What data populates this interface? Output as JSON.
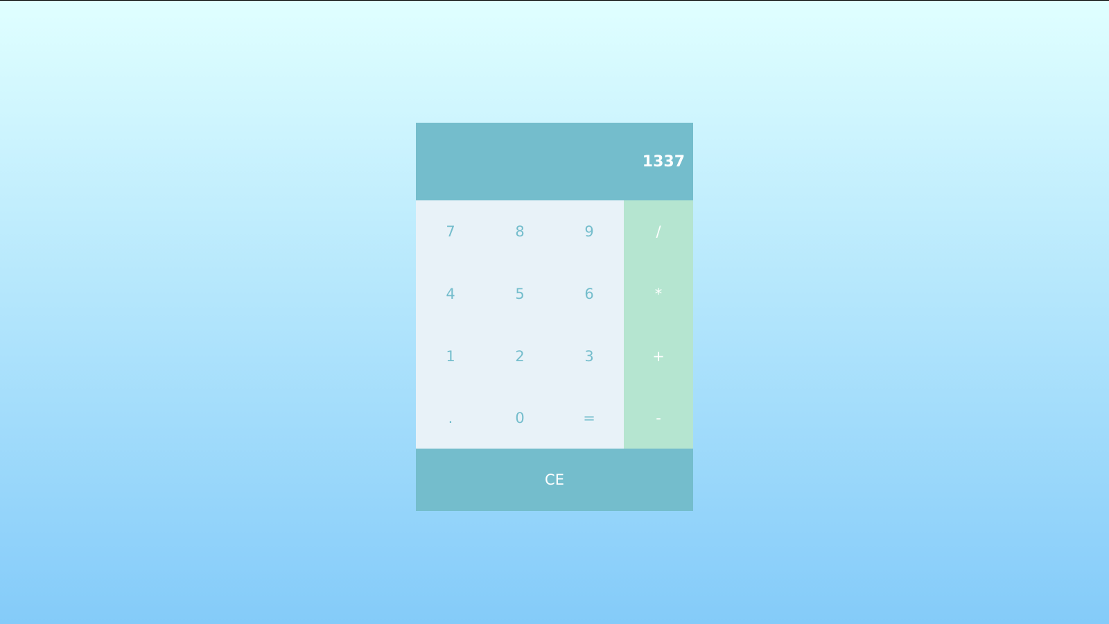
{
  "display": {
    "value": "1337"
  },
  "keys": [
    {
      "label": "7",
      "type": "digit"
    },
    {
      "label": "8",
      "type": "digit"
    },
    {
      "label": "9",
      "type": "digit"
    },
    {
      "label": "/",
      "type": "operator"
    },
    {
      "label": "4",
      "type": "digit"
    },
    {
      "label": "5",
      "type": "digit"
    },
    {
      "label": "6",
      "type": "digit"
    },
    {
      "label": "*",
      "type": "operator"
    },
    {
      "label": "1",
      "type": "digit"
    },
    {
      "label": "2",
      "type": "digit"
    },
    {
      "label": "3",
      "type": "digit"
    },
    {
      "label": "+",
      "type": "operator"
    },
    {
      "label": ".",
      "type": "digit"
    },
    {
      "label": "0",
      "type": "digit"
    },
    {
      "label": "=",
      "type": "digit"
    },
    {
      "label": "-",
      "type": "operator"
    }
  ],
  "clear": {
    "label": "CE"
  },
  "colors": {
    "accent": "#74bdcc",
    "keypad_background": "#e8f2f8",
    "operator_background": "#b5e5d0",
    "background_top": "#e0ffff",
    "background_bottom": "#84cbf9"
  }
}
